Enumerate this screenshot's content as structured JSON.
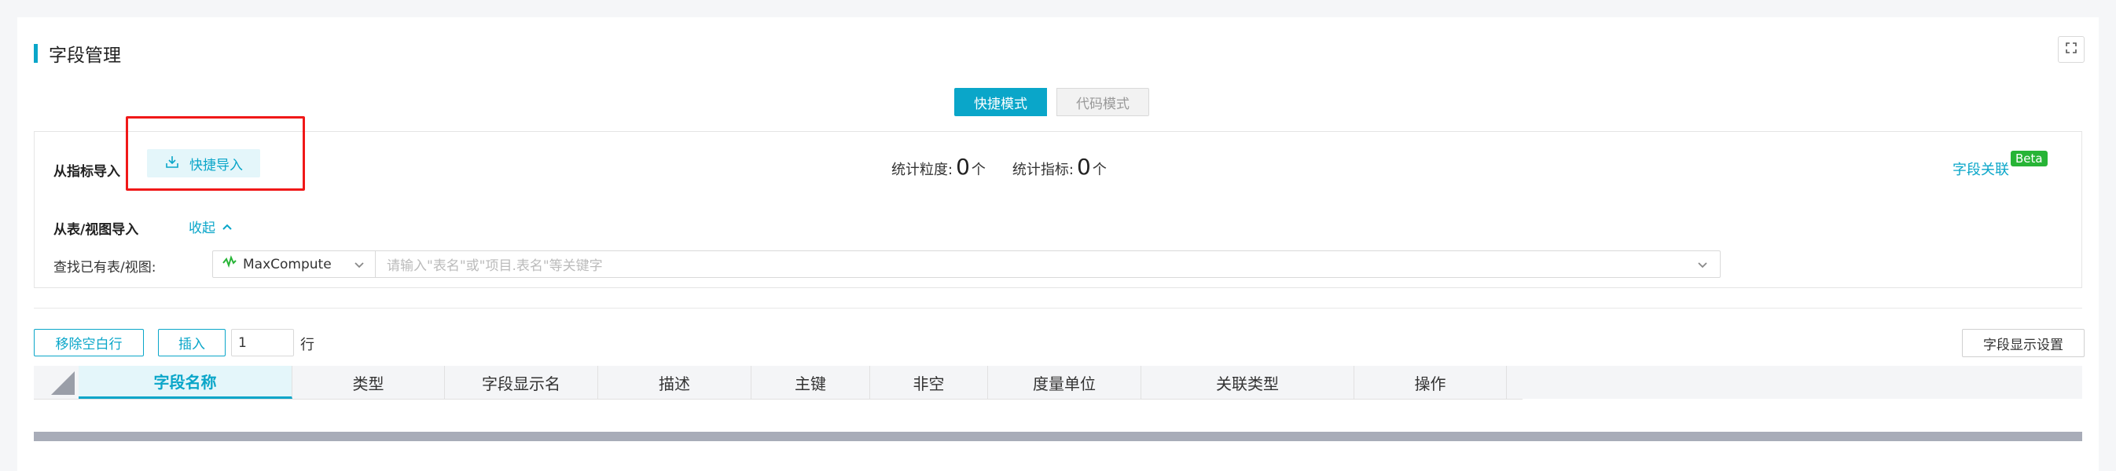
{
  "header": {
    "title": "字段管理"
  },
  "mode_switch": {
    "quick_label": "快捷模式",
    "code_label": "代码模式"
  },
  "import_from_metric": {
    "label": "从指标导入",
    "button_label": "快捷导入"
  },
  "stats": {
    "granularity_label": "统计粒度:",
    "granularity_count": "0",
    "metric_label": "统计指标:",
    "metric_count": "0",
    "unit": "个"
  },
  "field_link": {
    "label": "字段关联",
    "badge": "Beta"
  },
  "import_from_table": {
    "label": "从表/视图导入",
    "collapse_label": "收起",
    "search_label": "查找已有表/视图:",
    "source_value": "MaxCompute",
    "search_placeholder": "请输入\"表名\"或\"项目.表名\"等关键字"
  },
  "toolbar": {
    "remove_blank_label": "移除空白行",
    "insert_label": "插入",
    "insert_count": "1",
    "row_suffix": "行",
    "display_settings_label": "字段显示设置"
  },
  "grid": {
    "columns": [
      "字段名称",
      "类型",
      "字段显示名",
      "描述",
      "主键",
      "非空",
      "度量单位",
      "关联类型",
      "操作"
    ]
  },
  "colors": {
    "accent": "#0aa6c9",
    "beta": "#27b436",
    "highlight": "#f01818"
  },
  "icons": [
    "expand-icon",
    "import-icon",
    "chevron-up-icon",
    "maxcompute-icon",
    "chevron-down-icon"
  ]
}
